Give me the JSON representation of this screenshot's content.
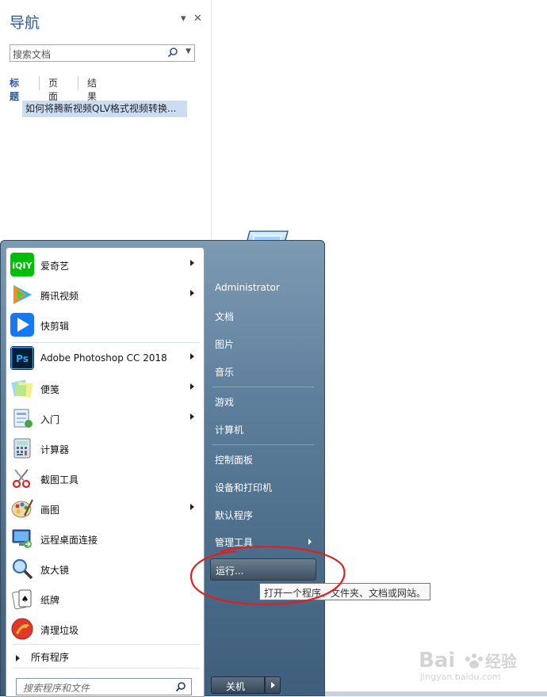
{
  "nav": {
    "title": "导航",
    "search_placeholder": "搜索文档",
    "tabs": [
      "标题",
      "页面",
      "结果"
    ],
    "heading": "如何将腾新视频QLV格式视频转换..."
  },
  "start_menu": {
    "programs": [
      {
        "label": "爱奇艺",
        "icon": "iqiyi-icon",
        "arrow": true
      },
      {
        "label": "腾讯视频",
        "icon": "tencent-video-icon",
        "arrow": true
      },
      {
        "label": "快剪辑",
        "icon": "kuaijianji-icon",
        "arrow": false
      },
      {
        "label": "Adobe Photoshop CC 2018",
        "icon": "photoshop-icon",
        "arrow": true
      },
      {
        "label": "便笺",
        "icon": "sticky-notes-icon",
        "arrow": true
      },
      {
        "label": "入门",
        "icon": "getting-started-icon",
        "arrow": true
      },
      {
        "label": "计算器",
        "icon": "calculator-icon",
        "arrow": false
      },
      {
        "label": "截图工具",
        "icon": "snipping-tool-icon",
        "arrow": false
      },
      {
        "label": "画图",
        "icon": "paint-icon",
        "arrow": true
      },
      {
        "label": "远程桌面连接",
        "icon": "remote-desktop-icon",
        "arrow": false
      },
      {
        "label": "放大镜",
        "icon": "magnifier-icon",
        "arrow": false
      },
      {
        "label": "纸牌",
        "icon": "solitaire-icon",
        "arrow": false
      },
      {
        "label": "清理垃圾",
        "icon": "cleanup-icon",
        "arrow": false
      }
    ],
    "all_programs": "所有程序",
    "search_placeholder": "搜索程序和文件",
    "right_items": {
      "user": "Administrator",
      "documents": "文档",
      "pictures": "图片",
      "music": "音乐",
      "games": "游戏",
      "computer": "计算机",
      "control_panel": "控制面板",
      "devices": "设备和打印机",
      "default_programs": "默认程序",
      "admin_tools": "管理工具",
      "run": "运行..."
    },
    "shutdown_label": "关机",
    "tooltip": "打开一个程序、文件夹、文档或网站。"
  },
  "watermark": {
    "brand": "Bai du 经验",
    "url": "jingyan.baidu.com"
  },
  "colors": {
    "accent": "#2b579a",
    "annotation": "#e02020",
    "selection": "#cbddf3"
  }
}
